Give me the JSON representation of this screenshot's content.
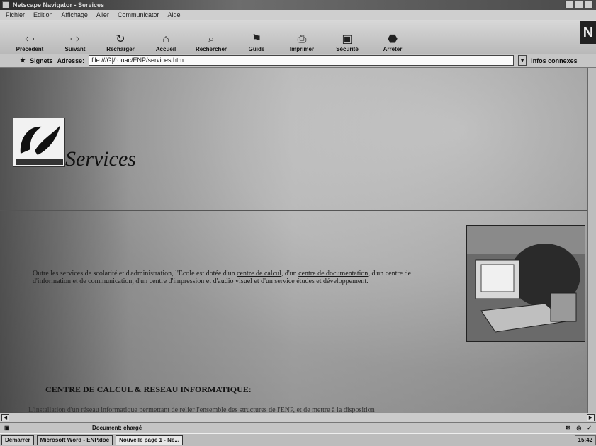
{
  "window": {
    "title": "Netscape Navigator - Services"
  },
  "menu": [
    "Fichier",
    "Edition",
    "Affichage",
    "Aller",
    "Communicator",
    "Aide"
  ],
  "toolbar": {
    "buttons": [
      {
        "label": "Précédent",
        "icon": "back-arrow-icon"
      },
      {
        "label": "Suivant",
        "icon": "forward-arrow-icon"
      },
      {
        "label": "Recharger",
        "icon": "reload-icon"
      },
      {
        "label": "Accueil",
        "icon": "home-icon"
      },
      {
        "label": "Rechercher",
        "icon": "search-icon"
      },
      {
        "label": "Guide",
        "icon": "guide-icon"
      },
      {
        "label": "Imprimer",
        "icon": "print-icon"
      },
      {
        "label": "Sécurité",
        "icon": "lock-icon"
      },
      {
        "label": "Arrêter",
        "icon": "stop-icon"
      }
    ],
    "brand": "N"
  },
  "addressbar": {
    "signets_label": "Signets",
    "adresse_label": "Adresse:",
    "url": "file:///G|/rouac/ENP/services.htm",
    "related_label": "Infos connexes"
  },
  "page": {
    "title": "Services",
    "intro_before": "Outre les services de scolarité et d'administration, l'Ecole est dotée d'un ",
    "intro_link1": "centre de calcul",
    "intro_between": ", d'un ",
    "intro_link2": "centre de documentation",
    "intro_after": ", d'un centre de d'information et de communication, d'un centre d'impression et d'audio visuel et d'un service études et développement.",
    "section_heading": "CENTRE DE CALCUL & RESEAU INFORMATIQUE:",
    "cut_line": "L'installation d'un réseau informatique permettant de relier l'ensemble des structures de l'ENP, et de mettre à la disposition"
  },
  "status": {
    "text": "Document: chargé"
  },
  "taskbar": {
    "start": "Démarrer",
    "tasks": [
      "Microsoft Word - ENP.doc",
      "Nouvelle page 1 - Ne..."
    ],
    "clock": "15:42"
  },
  "colors": {
    "chrome": "#c6c6c6",
    "url_bg": "#fafafa",
    "text": "#111111"
  }
}
